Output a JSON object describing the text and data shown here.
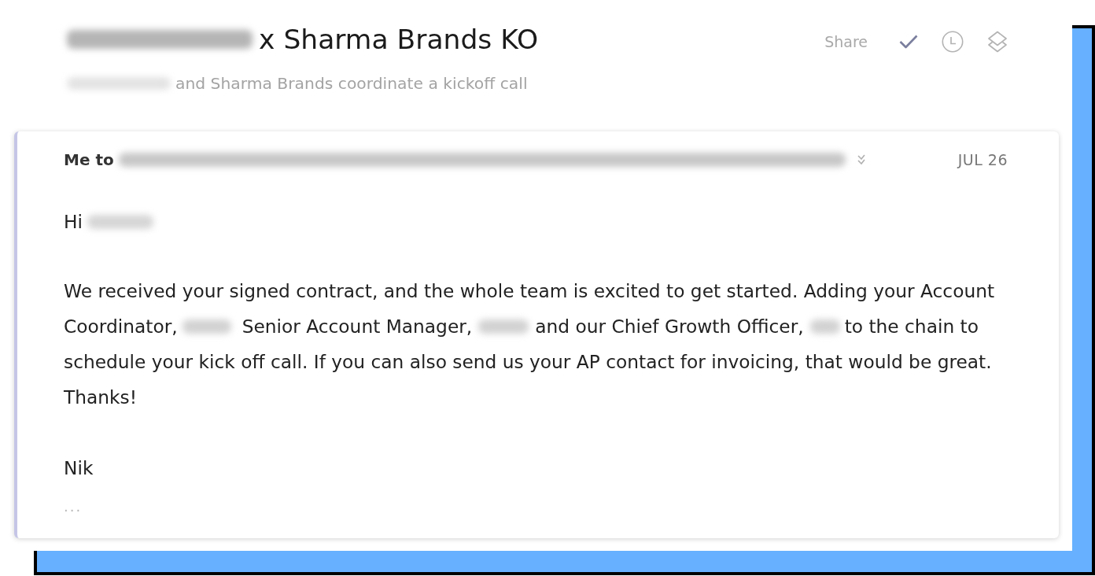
{
  "thread": {
    "title": {
      "parts": [
        {
          "kind": "redacted"
        },
        {
          "kind": "text",
          "text": "x Sharma Brands KO"
        }
      ]
    },
    "subtitle": {
      "parts": [
        {
          "kind": "redacted"
        },
        {
          "kind": "text",
          "text": "and Sharma Brands coordinate a kickoff call"
        }
      ]
    },
    "actions": {
      "share": "Share"
    }
  },
  "message": {
    "from_line": "Me to",
    "recipients": {
      "kind": "redacted"
    },
    "date": "JUL 26",
    "greeting": {
      "parts": [
        {
          "kind": "text",
          "text": "Hi"
        },
        {
          "kind": "redacted"
        }
      ]
    },
    "paragraph": {
      "lines": [
        {
          "segments": [
            {
              "kind": "text",
              "text": "We received your signed contract, and the whole team is excited to get started. Adding your Account"
            }
          ]
        },
        {
          "segments": [
            {
              "kind": "text",
              "text": "Coordinator,"
            },
            {
              "kind": "redacted"
            },
            {
              "kind": "text",
              "text": "Senior Account Manager,"
            },
            {
              "kind": "redacted"
            },
            {
              "kind": "text",
              "text": "and our Chief Growth Officer,"
            },
            {
              "kind": "redacted"
            },
            {
              "kind": "text",
              "text": "to the chain to"
            }
          ]
        },
        {
          "segments": [
            {
              "kind": "text",
              "text": "schedule your kick off call. If you can also send us your AP contact for invoicing, that would be great."
            }
          ]
        },
        {
          "segments": [
            {
              "kind": "text",
              "text": "Thanks!"
            }
          ]
        }
      ]
    },
    "signature": "Nik",
    "trimmed": "..."
  }
}
